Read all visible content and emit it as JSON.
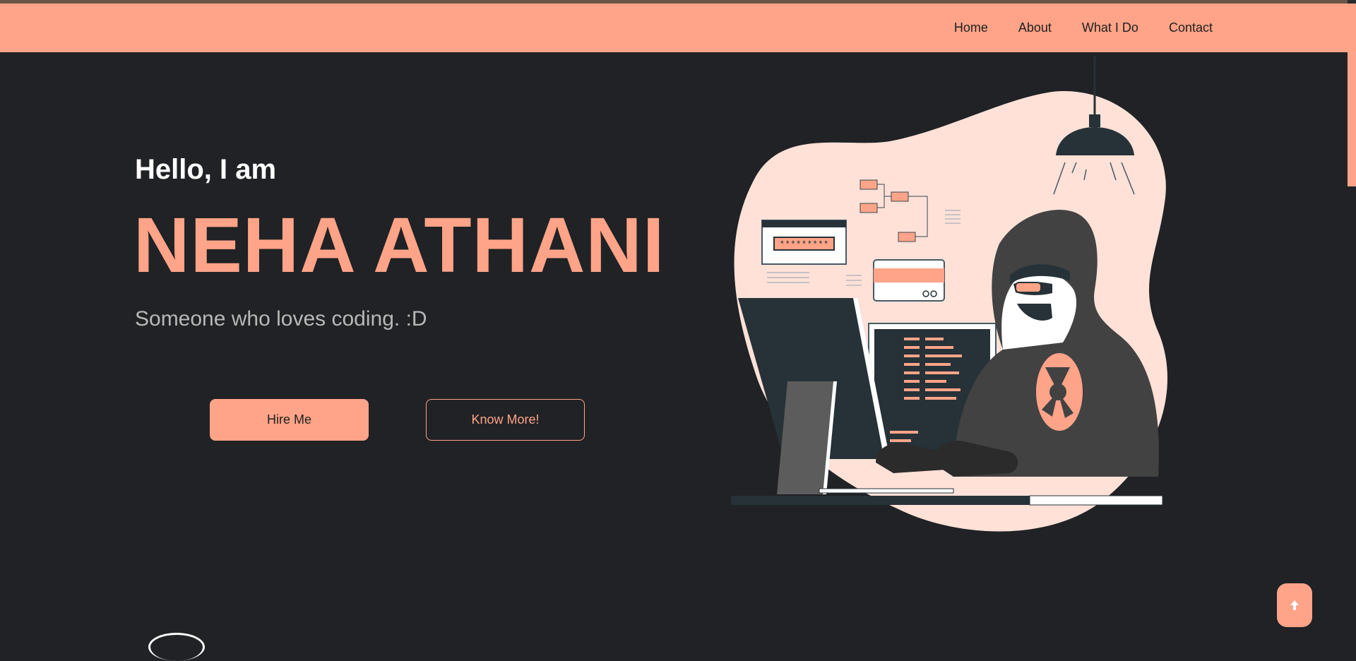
{
  "nav": {
    "items": [
      {
        "label": "Home"
      },
      {
        "label": "About"
      },
      {
        "label": "What I Do"
      },
      {
        "label": "Contact"
      }
    ]
  },
  "hero": {
    "greeting": "Hello, I am",
    "name": "NEHA ATHANI",
    "tagline": "Someone who loves coding. :D",
    "hire_label": "Hire Me",
    "more_label": "Know More!",
    "password_mask": "*********"
  },
  "colors": {
    "accent": "#ffa488",
    "background": "#202225",
    "text": "#ffffff",
    "muted": "#b8b8b8"
  },
  "icons": {
    "scroll_top": "arrow-up-icon"
  }
}
